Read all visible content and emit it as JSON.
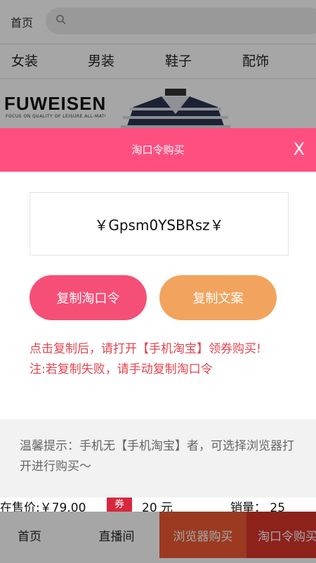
{
  "topbar": {
    "home_label": "首页",
    "search_placeholder": ""
  },
  "categories": [
    "女装",
    "男装",
    "鞋子",
    "配饰"
  ],
  "product": {
    "brand_name": "FUWEISEN",
    "brand_tagline": "FOCUS ON QUALITY OF LEISURE ALL-MATCH"
  },
  "modal": {
    "title": "淘口令购买",
    "close_label": "X",
    "code": "￥Gpsm0YSBRsz￥",
    "copy_code_label": "复制淘口令",
    "copy_text_label": "复制文案",
    "instruction_line1": "点击复制后，请打开【手机淘宝】领券购买!",
    "instruction_line2": "注:若复制失败，请手动复制淘口令",
    "tip": "温馨提示：手机无【手机淘宝】者，可选择浏览器打开进行购买～"
  },
  "info": {
    "price": "在售价:￥79.00",
    "coupon_badge": "券",
    "coupon_amount": "20 元",
    "sales": "销量： 25"
  },
  "tabbar": {
    "home": "首页",
    "live": "直播间",
    "browser_buy": "浏览器购买",
    "taokou_buy": "淘口令购买"
  },
  "colors": {
    "modal_header": "#ff4f80",
    "copy_code_button": "#f64f77",
    "copy_text_button": "#f2a45e",
    "instruction_text": "#e0464f",
    "browser_buy_tab": "#ef5a33",
    "taokou_buy_tab": "#d9352a"
  }
}
